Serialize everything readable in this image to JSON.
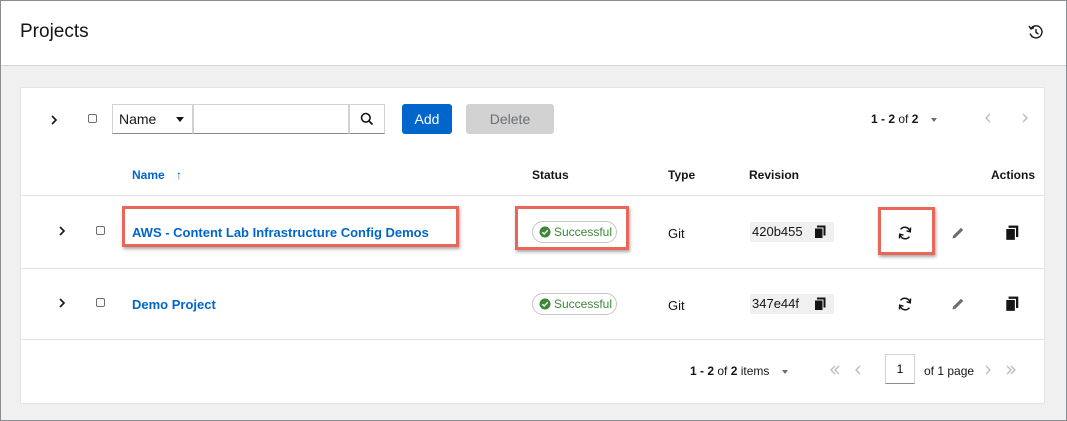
{
  "page": {
    "title": "Projects",
    "history_icon": "history-icon"
  },
  "toolbar": {
    "filter_select_value": "Name",
    "search_value": "",
    "search_placeholder": "",
    "search_icon": "search-icon",
    "add_label": "Add",
    "delete_label": "Delete",
    "pagination_range": "1 - 2",
    "pagination_of": "of",
    "pagination_total": "2"
  },
  "table": {
    "columns": {
      "name": "Name",
      "sort_icon": "↑",
      "status": "Status",
      "type": "Type",
      "revision": "Revision",
      "actions": "Actions"
    },
    "rows": [
      {
        "name": "AWS - Content Lab Infrastructure Config Demos",
        "status": "Successful",
        "type": "Git",
        "revision": "420b455",
        "highlighted": true
      },
      {
        "name": "Demo Project",
        "status": "Successful",
        "type": "Git",
        "revision": "347e44f",
        "highlighted": false
      }
    ]
  },
  "pagination_bottom": {
    "range": "1 - 2",
    "of_label": "of",
    "total": "2",
    "items_label": "items",
    "current_page": "1",
    "of_pages": "of 1 page"
  },
  "colors": {
    "link": "#0066cc",
    "primary_button": "#0066cc",
    "success": "#3e8635",
    "highlight": "#e8665a"
  }
}
